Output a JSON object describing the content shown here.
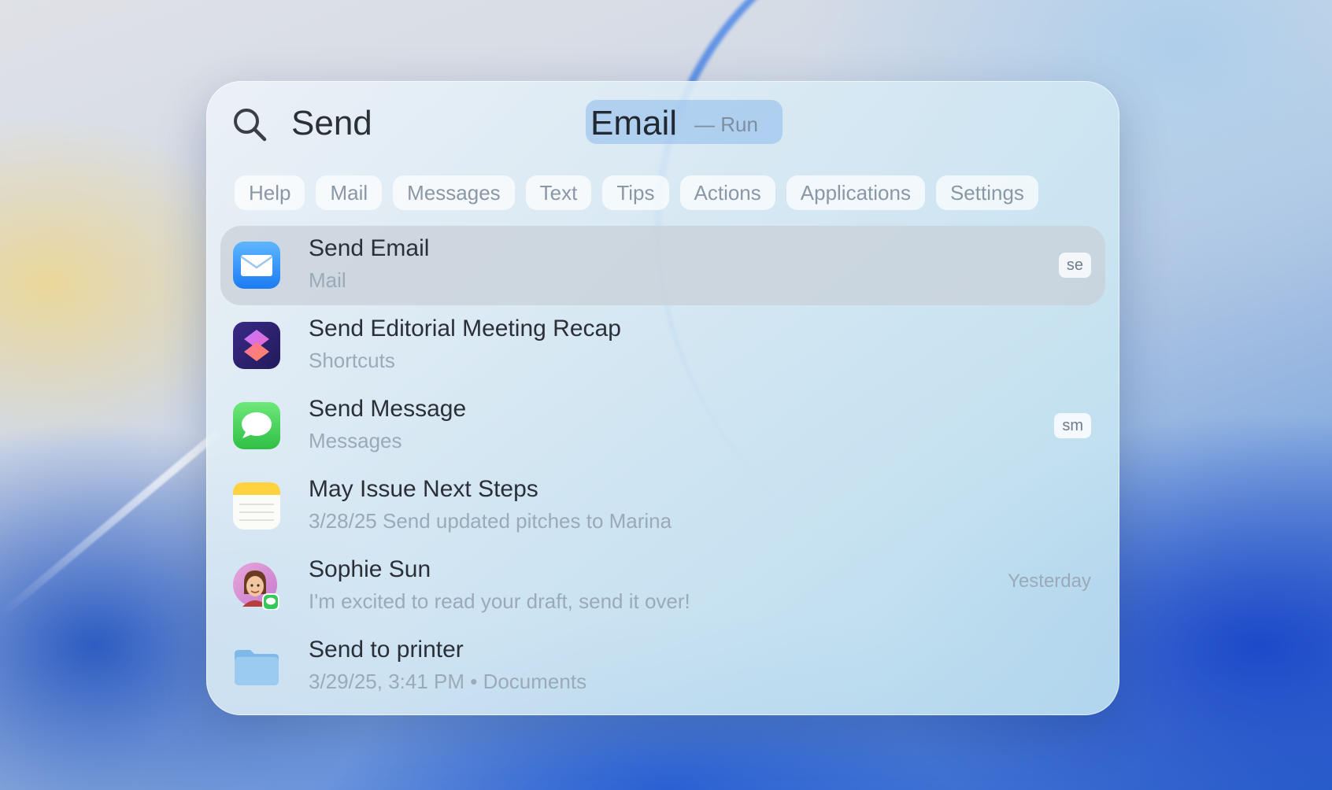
{
  "search": {
    "typed": "Send",
    "completion": "Email",
    "hint": "— Run"
  },
  "filters": [
    "Help",
    "Mail",
    "Messages",
    "Text",
    "Tips",
    "Actions",
    "Applications",
    "Settings"
  ],
  "results": [
    {
      "title": "Send Email",
      "subtitle": "Mail",
      "badge": "se",
      "time": "",
      "icon": "mail-icon"
    },
    {
      "title": "Send Editorial Meeting Recap",
      "subtitle": "Shortcuts",
      "badge": "",
      "time": "",
      "icon": "shortcuts-icon"
    },
    {
      "title": "Send Message",
      "subtitle": "Messages",
      "badge": "sm",
      "time": "",
      "icon": "messages-icon"
    },
    {
      "title": "May Issue Next Steps",
      "subtitle": "3/28/25 Send updated pitches to Marina",
      "badge": "",
      "time": "",
      "icon": "notes-icon"
    },
    {
      "title": "Sophie Sun",
      "subtitle": "I'm excited to read your draft, send it over!",
      "badge": "",
      "time": "Yesterday",
      "icon": "contact-avatar-icon"
    },
    {
      "title": "Send to printer",
      "subtitle": "3/29/25, 3:41 PM • Documents",
      "badge": "",
      "time": "",
      "icon": "folder-icon"
    }
  ],
  "colors": {
    "selected_row": "#c8d0d8",
    "title_text": "#2a2f38",
    "subtitle_text": "#9aaab8",
    "query_highlight": "#8cb9eb"
  }
}
